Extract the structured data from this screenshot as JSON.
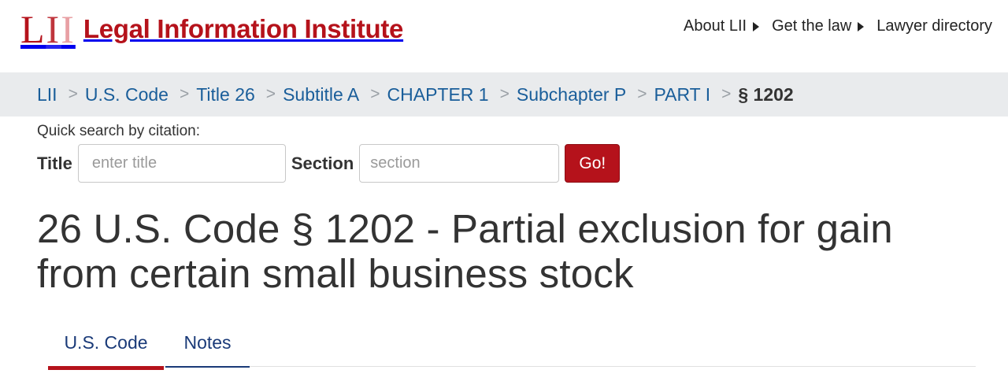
{
  "header": {
    "logo_mark": "LII",
    "logo_text": "Legal Information Institute",
    "nav": [
      {
        "label": "About LII"
      },
      {
        "label": "Get the law"
      },
      {
        "label": "Lawyer directory"
      }
    ]
  },
  "breadcrumb": {
    "items": [
      {
        "label": "LII"
      },
      {
        "label": "U.S. Code"
      },
      {
        "label": "Title 26"
      },
      {
        "label": "Subtitle A"
      },
      {
        "label": "CHAPTER 1"
      },
      {
        "label": "Subchapter P"
      },
      {
        "label": "PART I"
      }
    ],
    "separator": ">",
    "current": "§ 1202"
  },
  "quick_search": {
    "label": "Quick search by citation:",
    "title_label": "Title",
    "title_placeholder": "enter title",
    "section_label": "Section",
    "section_placeholder": "section",
    "go_label": "Go!"
  },
  "page": {
    "title": "26 U.S. Code § 1202 - Partial exclusion for gain from certain small business stock"
  },
  "tabs": [
    {
      "label": "U.S. Code",
      "active": true
    },
    {
      "label": "Notes",
      "active": false
    }
  ],
  "colors": {
    "brand_red": "#b5121b",
    "link_blue": "#1a5e9a",
    "tab_navy": "#1a3a78",
    "breadcrumb_bg": "#e9ebed"
  },
  "icons": {
    "nav_arrow": "caret-right-icon"
  }
}
